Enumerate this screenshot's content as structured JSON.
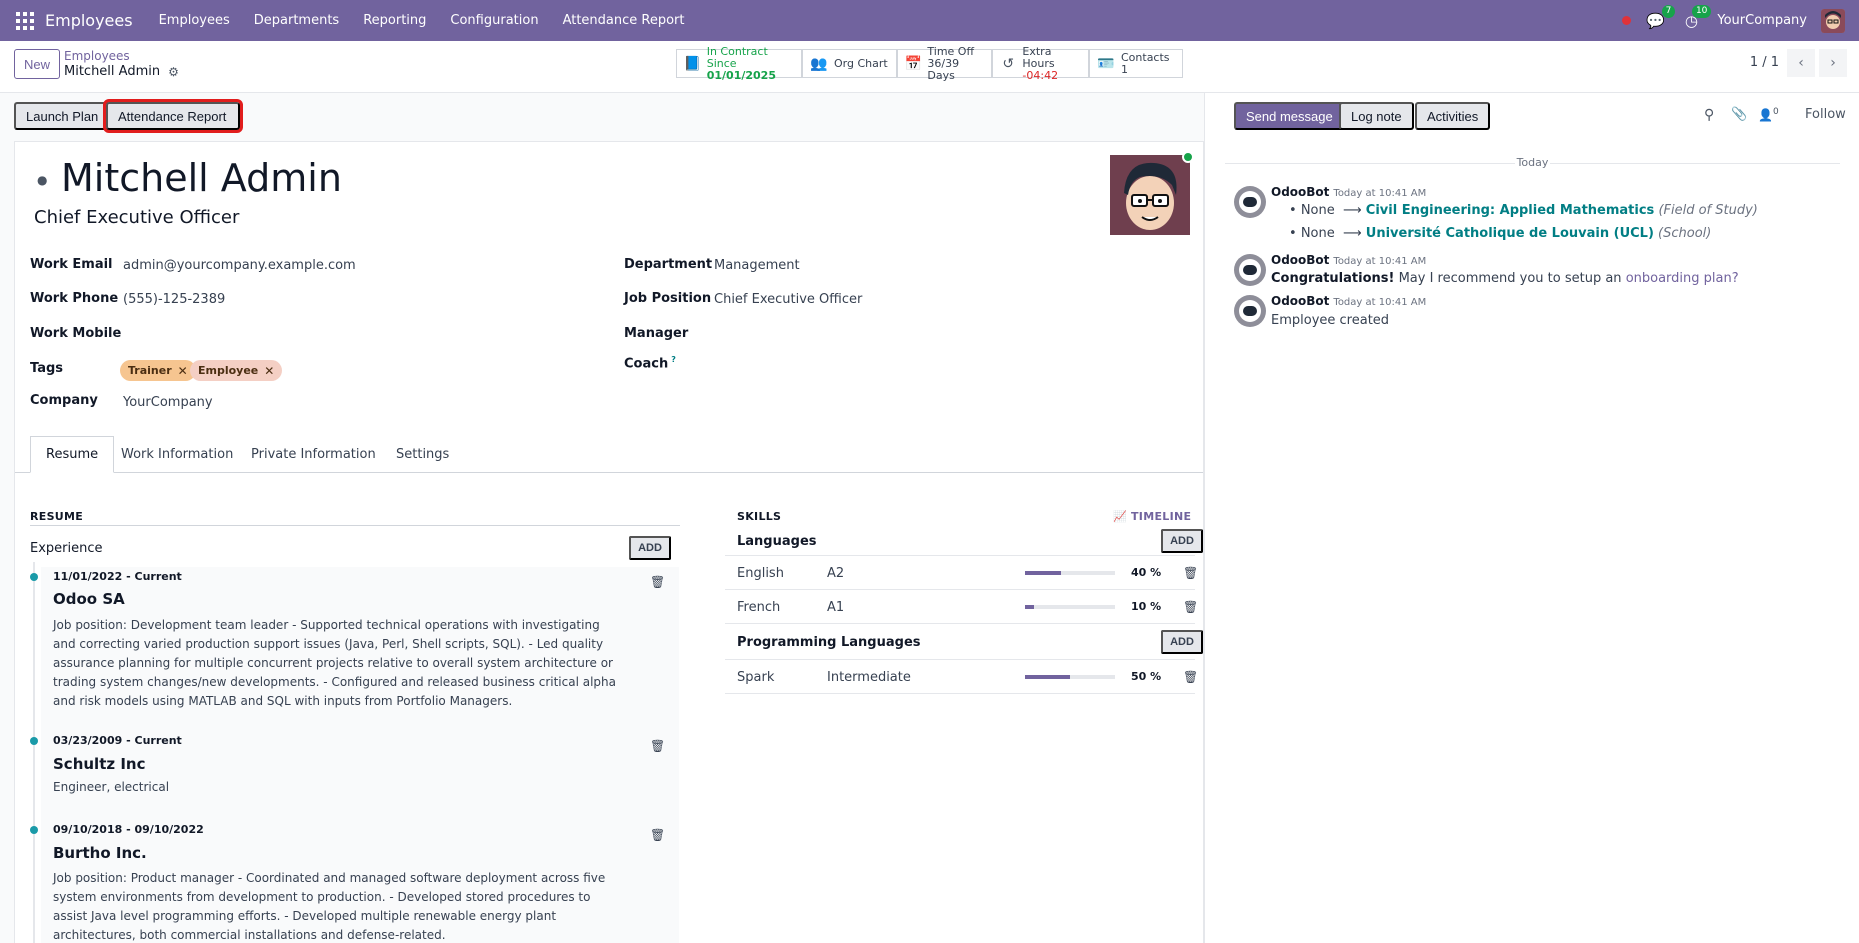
{
  "navbar": {
    "app_name": "Employees",
    "menus": [
      "Employees",
      "Departments",
      "Reporting",
      "Configuration",
      "Attendance Report"
    ],
    "messages_badge": "7",
    "activities_badge": "10",
    "company": "YourCompany"
  },
  "control_panel": {
    "new_label": "New",
    "breadcrumb_parent": "Employees",
    "breadcrumb_current": "Mitchell Admin",
    "smart_buttons": {
      "contract": {
        "line1": "In Contract Since",
        "line2": "01/01/2025"
      },
      "org_chart": {
        "line1": "Org Chart"
      },
      "time_off": {
        "line1": "Time Off",
        "line2": "36/39 Days"
      },
      "extra_hours": {
        "line1": "Extra Hours",
        "line2": "-04:42"
      },
      "contacts": {
        "line1": "Contacts",
        "line2": "1"
      }
    },
    "pager": "1 / 1"
  },
  "actions": {
    "launch_plan": "Launch Plan",
    "attendance_report": "Attendance Report"
  },
  "employee": {
    "name": "Mitchell Admin",
    "job_title": "Chief Executive Officer",
    "fields_left": [
      {
        "label": "Work Email",
        "value": "admin@yourcompany.example.com"
      },
      {
        "label": "Work Phone",
        "value": "(555)-125-2389"
      },
      {
        "label": "Work Mobile",
        "value": ""
      },
      {
        "label": "Tags",
        "value": ""
      },
      {
        "label": "Company",
        "value": "YourCompany"
      }
    ],
    "tags": [
      "Trainer",
      "Employee"
    ],
    "fields_right": [
      {
        "label": "Department",
        "value": "Management"
      },
      {
        "label": "Job Position",
        "value": "Chief Executive Officer"
      },
      {
        "label": "Manager",
        "value": ""
      },
      {
        "label": "Coach",
        "value": ""
      }
    ],
    "coach_help": "?"
  },
  "tabs": [
    "Resume",
    "Work Information",
    "Private Information",
    "Settings"
  ],
  "resume": {
    "heading": "RESUME",
    "experience_label": "Experience",
    "add_label": "ADD",
    "items": [
      {
        "date": "11/01/2022 - Current",
        "title": "Odoo SA",
        "description": "Job position: Development team leader - Supported technical operations with investigating and correcting varied production support issues (Java, Perl, Shell scripts, SQL). - Led quality assurance planning for multiple concurrent projects relative to overall system architecture or trading system changes/new developments. - Configured and released business critical alpha and risk models using MATLAB and SQL with inputs from Portfolio Managers."
      },
      {
        "date": "03/23/2009 - Current",
        "title": "Schultz Inc",
        "description": "Engineer, electrical"
      },
      {
        "date": "09/10/2018 - 09/10/2022",
        "title": "Burtho Inc.",
        "description": "Job position: Product manager - Coordinated and managed software deployment across five system environments from development to production. - Developed stored procedures to assist Java level programming efforts. - Developed multiple renewable energy plant architectures, both commercial installations and defense-related."
      }
    ]
  },
  "skills": {
    "heading": "SKILLS",
    "timeline_label": "TIMELINE",
    "add_label": "ADD",
    "groups": [
      {
        "name": "Languages",
        "rows": [
          {
            "skill": "English",
            "level": "A2",
            "percent": 40,
            "percent_label": "40 %"
          },
          {
            "skill": "French",
            "level": "A1",
            "percent": 10,
            "percent_label": "10 %"
          }
        ]
      },
      {
        "name": "Programming Languages",
        "rows": [
          {
            "skill": "Spark",
            "level": "Intermediate",
            "percent": 50,
            "percent_label": "50 %"
          }
        ]
      }
    ]
  },
  "chatter": {
    "send_message": "Send message",
    "log_note": "Log note",
    "activities": "Activities",
    "followers_count": "0",
    "follow": "Follow",
    "today": "Today",
    "messages": [
      {
        "author": "OdooBot",
        "time": "Today at 10:41 AM",
        "changes": [
          {
            "old": "None",
            "new": "Civil Engineering: Applied Mathematics",
            "field": "(Field of Study)"
          },
          {
            "old": "None",
            "new": "Université Catholique de Louvain (UCL)",
            "field": "(School)"
          }
        ]
      },
      {
        "author": "OdooBot",
        "time": "Today at 10:41 AM",
        "bold": "Congratulations!",
        "text": " May I recommend you to setup an ",
        "link": "onboarding plan?"
      },
      {
        "author": "OdooBot",
        "time": "Today at 10:41 AM",
        "text": "Employee created"
      }
    ]
  },
  "colors": {
    "brand": "#71639e",
    "highlight": "#e11d1d",
    "link": "#017e84",
    "online": "#16a34a"
  }
}
